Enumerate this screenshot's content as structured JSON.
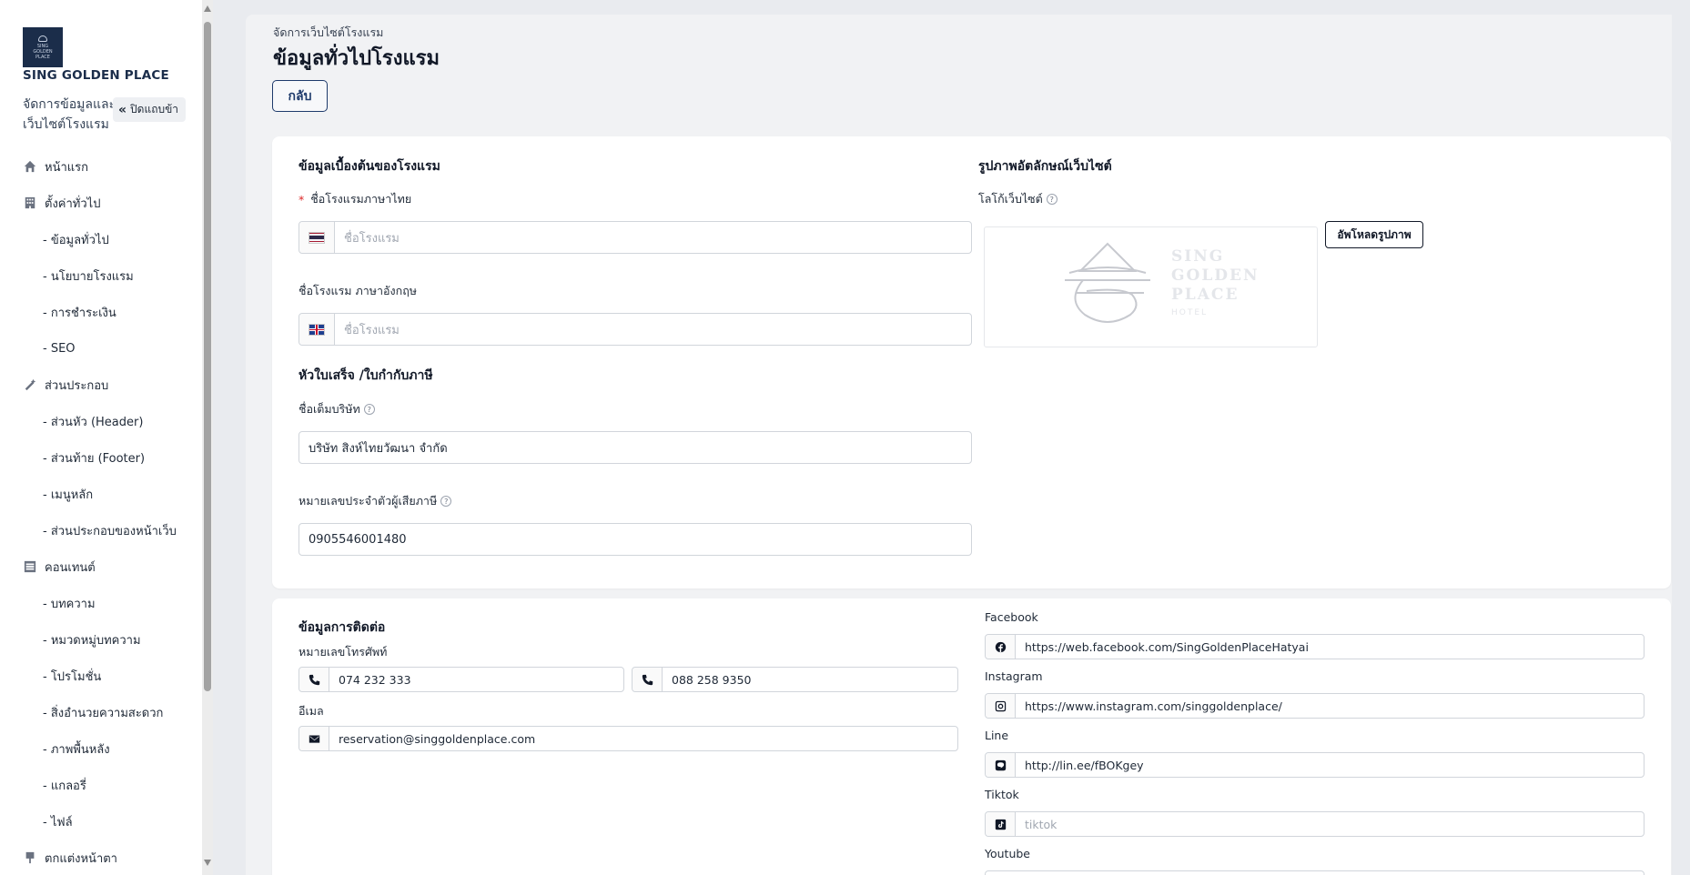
{
  "sidebar": {
    "brand": {
      "name": "SING GOLDEN PLACE",
      "logo_lines": [
        "SING",
        "GOLDEN",
        "PLACE"
      ],
      "subtitle": "จัดการข้อมูลและเว็บไซต์โรงแรม"
    },
    "collapse_label": "ปิดแถบข้า",
    "items": [
      {
        "label": "หน้าแรก",
        "icon": "home-icon"
      },
      {
        "label": "ตั้งค่าทั่วไป",
        "icon": "building-icon"
      },
      {
        "label": "- ข้อมูลทั่วไป"
      },
      {
        "label": "- นโยบายโรงแรม"
      },
      {
        "label": "- การชำระเงิน"
      },
      {
        "label": "- SEO"
      },
      {
        "label": "ส่วนประกอบ",
        "icon": "magic-wand-icon"
      },
      {
        "label": "- ส่วนหัว (Header)"
      },
      {
        "label": "- ส่วนท้าย (Footer)"
      },
      {
        "label": "- เมนูหลัก"
      },
      {
        "label": "- ส่วนประกอบของหน้าเว็บ"
      },
      {
        "label": "คอนเทนต์",
        "icon": "list-icon"
      },
      {
        "label": "- บทความ"
      },
      {
        "label": "- หมวดหมู่บทความ"
      },
      {
        "label": "- โปรโมชั่น"
      },
      {
        "label": "- สิ่งอำนวยความสะดวก"
      },
      {
        "label": "- ภาพพื้นหลัง"
      },
      {
        "label": "- แกลอรี่"
      },
      {
        "label": "- ไฟล์"
      },
      {
        "label": "ตกแต่งหน้าตา",
        "icon": "paint-icon"
      }
    ]
  },
  "header": {
    "breadcrumb": "จัดการเว็บไซต์โรงแรม",
    "title": "ข้อมูลทั่วไปโรงแรม",
    "back_label": "กลับ"
  },
  "basic": {
    "section_title": "ข้อมูลเบื้องต้นของโรงแรม",
    "name_th_label": "ชื่อโรงแรมภาษาไทย",
    "name_th_placeholder": "ชื่อโรงแรม",
    "name_en_label": "ชื่อโรงแรม ภาษาอังกฤษ",
    "name_en_placeholder": "ชื่อโรงแรม",
    "receipt_title": "หัวใบเสร็จ /ใบกำกับภาษี",
    "company_label": "ชื่อเต็มบริษัท",
    "company_value": "บริษัท สิงห์ไทยวัฒนา จำกัด",
    "tax_label": "หมายเลขประจำตัวผู้เสียภาษี",
    "tax_value": "0905546001480"
  },
  "identity": {
    "section_title": "รูปภาพอัตลักษณ์เว็บไซต์",
    "logo_label": "โลโก้เว็บไซต์",
    "upload_label": "อัพโหลดรูปภาพ",
    "logo_text": [
      "SING",
      "GOLDEN",
      "PLACE",
      "HOTEL"
    ]
  },
  "contact": {
    "section_title": "ข้อมูลการติดต่อ",
    "phone_label": "หมายเลขโทรศัพท์",
    "phone1": "074 232 333",
    "phone2": "088 258 9350",
    "email_label": "อีเมล",
    "email": "reservation@singgoldenplace.com",
    "facebook_label": "Facebook",
    "facebook": "https://web.facebook.com/SingGoldenPlaceHatyai",
    "instagram_label": "Instagram",
    "instagram": "https://www.instagram.com/singgoldenplace/",
    "line_label": "Line",
    "line": "http://lin.ee/fBOKgey",
    "tiktok_label": "Tiktok",
    "tiktok_placeholder": "tiktok",
    "youtube_label": "Youtube"
  },
  "colors": {
    "brand_navy": "#1b2d4a",
    "required": "#dc2626",
    "background": "#e9ebef"
  }
}
